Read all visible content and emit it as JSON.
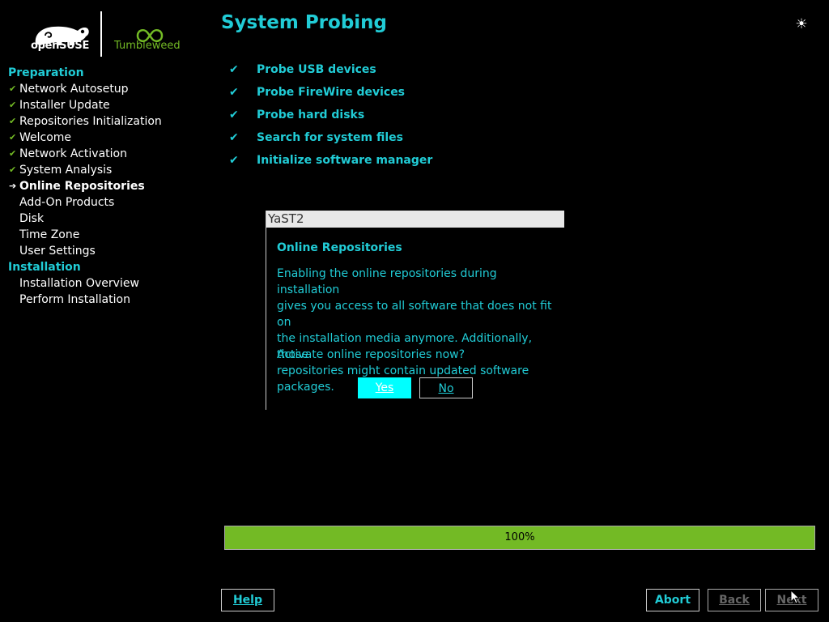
{
  "branding": {
    "opensuse_text": "openSUSE",
    "tumbleweed_text": "Tumbleweed"
  },
  "header": {
    "title": "System Probing",
    "theme_icon": "brightness-icon"
  },
  "sidebar": {
    "sections": [
      {
        "label": "Preparation",
        "items": [
          {
            "label": "Network Autosetup",
            "state": "done"
          },
          {
            "label": "Installer Update",
            "state": "done"
          },
          {
            "label": "Repositories Initialization",
            "state": "done"
          },
          {
            "label": "Welcome",
            "state": "done"
          },
          {
            "label": "Network Activation",
            "state": "done"
          },
          {
            "label": "System Analysis",
            "state": "done"
          },
          {
            "label": "Online Repositories",
            "state": "current"
          },
          {
            "label": "Add-On Products",
            "state": "todo"
          },
          {
            "label": "Disk",
            "state": "todo"
          },
          {
            "label": "Time Zone",
            "state": "todo"
          },
          {
            "label": "User Settings",
            "state": "todo"
          }
        ]
      },
      {
        "label": "Installation",
        "items": [
          {
            "label": "Installation Overview",
            "state": "todo"
          },
          {
            "label": "Perform Installation",
            "state": "todo"
          }
        ]
      }
    ]
  },
  "probes": [
    {
      "label": "Probe USB devices",
      "mark": "✔"
    },
    {
      "label": "Probe FireWire devices",
      "mark": "✔"
    },
    {
      "label": "Probe hard disks",
      "mark": "✔"
    },
    {
      "label": "Search for system files",
      "mark": "✔"
    },
    {
      "label": "Initialize software manager",
      "mark": "✔"
    }
  ],
  "popup": {
    "window_title": "YaST2",
    "heading": "Online Repositories",
    "body_lines": [
      "Enabling the online repositories during installation",
      "gives you access to all software that does not fit on",
      "the installation media anymore. Additionally, those",
      "repositories might contain updated software packages."
    ],
    "question": "Activate online repositories now?",
    "yes_label": "Yes",
    "no_label": "No"
  },
  "progress": {
    "value": 100,
    "label": "100%"
  },
  "buttons": {
    "help": "Help",
    "abort": "Abort",
    "back": "Back",
    "next": "Next"
  },
  "colors": {
    "accent": "#21ccd6",
    "green": "#73ba25",
    "background": "#000000"
  }
}
